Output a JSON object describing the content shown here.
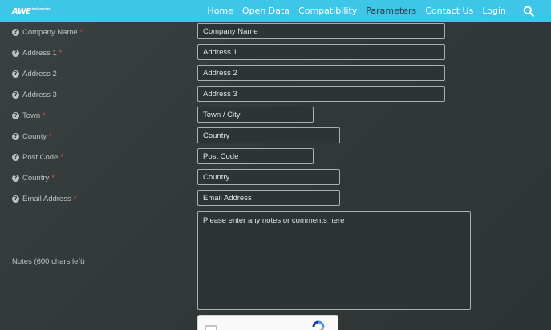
{
  "brand": {
    "logo": "AWE",
    "logo_sub": "Instruments"
  },
  "nav": {
    "home": "Home",
    "open_data": "Open Data",
    "compatibility": "Compatibility",
    "parameters": "Parameters",
    "contact": "Contact Us",
    "login": "Login"
  },
  "form": {
    "help_glyph": "?",
    "required_mark": "*",
    "company": {
      "label": "Company Name",
      "placeholder": "Company Name"
    },
    "address1": {
      "label": "Address 1",
      "placeholder": "Address 1"
    },
    "address2": {
      "label": "Address 2",
      "placeholder": "Address 2"
    },
    "address3": {
      "label": "Address 3",
      "placeholder": "Address 3"
    },
    "town": {
      "label": "Town",
      "placeholder": "Town / City"
    },
    "county": {
      "label": "County",
      "placeholder": "Country"
    },
    "postcode": {
      "label": "Post Code",
      "placeholder": "Post Code"
    },
    "country": {
      "label": "Country",
      "placeholder": "Country"
    },
    "email": {
      "label": "Email Address",
      "placeholder": "Email Address"
    },
    "notes": {
      "label": "Notes (600 chars left)",
      "placeholder": "Please enter any notes or comments here"
    }
  },
  "colors": {
    "navbar": "#3ec6e8",
    "active_nav": "#2a3d44",
    "required": "#e05050"
  }
}
